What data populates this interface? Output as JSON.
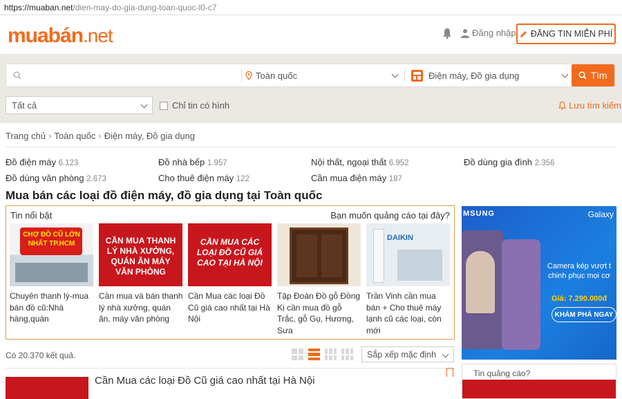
{
  "url": {
    "host": "https://muaban.net",
    "path": "/dien-may-do-gia-dung-toan-quoc-l0-c7"
  },
  "header": {
    "logo_main": "muabán",
    "logo_suffix": ".net",
    "login_label": "Đăng nhập",
    "post_button_label": "ĐĂNG TIN MIỄN PHÍ"
  },
  "search": {
    "keyword_placeholder": "",
    "location_value": "Toàn quốc",
    "category_value": "Điện máy, Đồ gia dụng",
    "button_label": "Tìm",
    "filter_value": "Tất cả",
    "photos_only_label": "Chỉ tin có hình",
    "save_search_label": "Lưu tìm kiếm"
  },
  "breadcrumb": [
    "Trang chủ",
    "Toàn quốc",
    "Điện máy, Đồ gia dụng"
  ],
  "categories": [
    {
      "name": "Đồ điện máy",
      "count": "6.123"
    },
    {
      "name": "Đồ nhà bếp",
      "count": "1.957"
    },
    {
      "name": "Nội thất, ngoại thất",
      "count": "6.952"
    },
    {
      "name": "Đồ dùng gia đình",
      "count": "2.356"
    },
    {
      "name": "Đồ dùng văn phòng",
      "count": "2.673"
    },
    {
      "name": "Cho thuê điện máy",
      "count": "122"
    },
    {
      "name": "Cần mua điện máy",
      "count": "187"
    }
  ],
  "page_title": "Mua bán các loại đồ điện máy, đồ gia dụng tại Toàn quốc",
  "featured": {
    "title": "Tin nổi bật",
    "ad_question": "Bạn muốn quảng cáo tại đây?",
    "items": [
      {
        "thumb_text": "CHỢ ĐỒ CŨ LỚN NHẤT TP.HCM",
        "caption": "Chuyên thanh lý-mua bán đồ cũ:Nhà hàng,quán"
      },
      {
        "thumb_text": "CẦN MUA THANH LÝ NHÀ XƯỞNG, QUÁN ĂN MÁY VĂN PHÒNG",
        "caption": "Cần mua và bán thanh lý nhà xưởng, quán ăn, máy văn phòng"
      },
      {
        "thumb_text": "CẦN MUA CÁC LOẠI ĐỒ CŨ GIÁ CAO TẠI HÀ NỘI",
        "caption": "Cần Mua các loại Đồ Cũ giá cao nhất tại Hà Nội"
      },
      {
        "thumb_text": "",
        "caption": "Tập Đoàn Đồ gỗ Đồng Kị cần mua đồ gỗ Trắc, gỗ Gụ, Hương, Sưa"
      },
      {
        "thumb_text": "DAIKIN",
        "caption": "Trần Vinh cần mua bán + Cho thuê máy lạnh cũ các loại, còn mới"
      }
    ]
  },
  "results": {
    "count_label": "Có 20.370 kết quả.",
    "sort_value": "Sắp xếp mặc định"
  },
  "listing": {
    "title": "Cần Mua các loại Đồ Cũ giá cao nhất tại Hà Nội"
  },
  "ad": {
    "brand": "MSUNG",
    "product": "Galaxy",
    "headline": "Camera kép vượt t chinh phục mọi cơ",
    "price": "Giá: 7.290.000đ",
    "cta": "KHÁM PHÁ NGAY",
    "ad2_label": "Tin quảng cáo?"
  },
  "colors": {
    "accent": "#f26b1d",
    "band": "#ece9e4",
    "featured_border": "#d6a052"
  }
}
